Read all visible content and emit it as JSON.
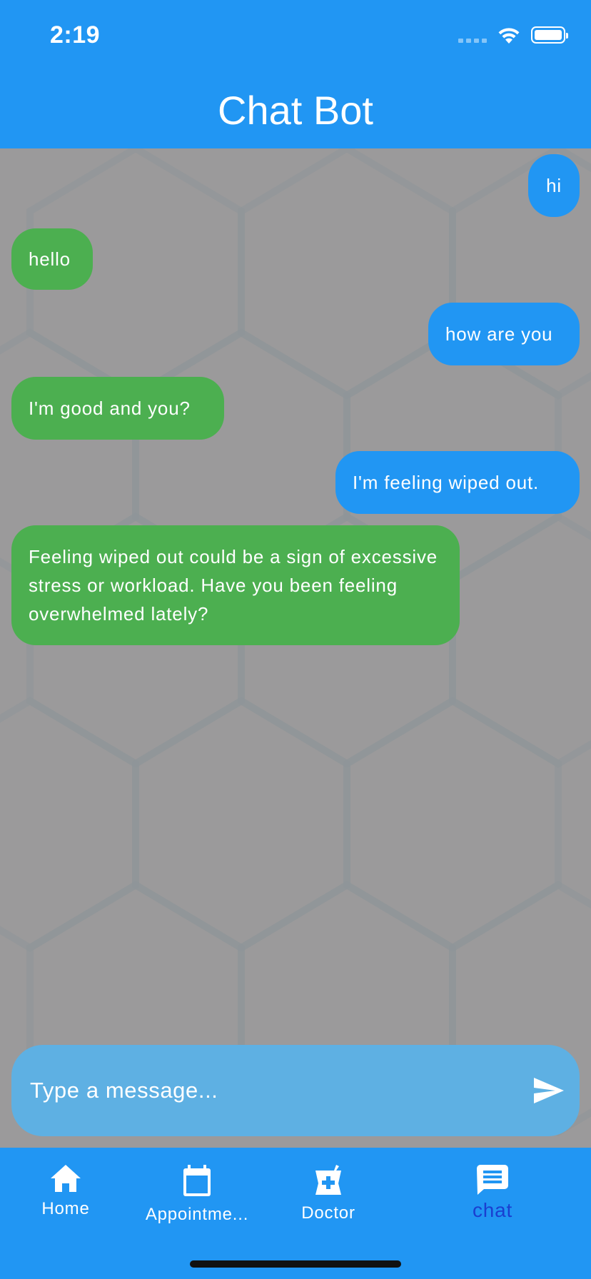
{
  "status_bar": {
    "time": "2:19"
  },
  "app_bar": {
    "title": "Chat Bot"
  },
  "messages": [
    {
      "sender": "user",
      "text": "hi"
    },
    {
      "sender": "bot",
      "text": "hello"
    },
    {
      "sender": "user",
      "text": "how are you"
    },
    {
      "sender": "bot",
      "text": "I'm good and you?"
    },
    {
      "sender": "user",
      "text": "I'm feeling wiped out."
    },
    {
      "sender": "bot",
      "text": "Feeling wiped out could be a sign of excessive stress or workload. Have you been feeling overwhelmed lately?"
    }
  ],
  "composer": {
    "placeholder": "Type a message...",
    "value": "",
    "send_icon": "send-icon"
  },
  "bottom_nav": {
    "items": [
      {
        "label": "Home",
        "icon": "home-icon",
        "active": false
      },
      {
        "label": "Appointme...",
        "icon": "calendar-icon",
        "active": false
      },
      {
        "label": "Doctor",
        "icon": "medical-bag-icon",
        "active": false
      },
      {
        "label": "chat",
        "icon": "chat-icon",
        "active": true
      }
    ]
  },
  "colors": {
    "primary": "#2196f3",
    "bot_bubble": "#4caf50",
    "chat_background": "#9b9a9b",
    "composer": "#5eb0e3",
    "active_nav_label": "#1a3fd0"
  }
}
